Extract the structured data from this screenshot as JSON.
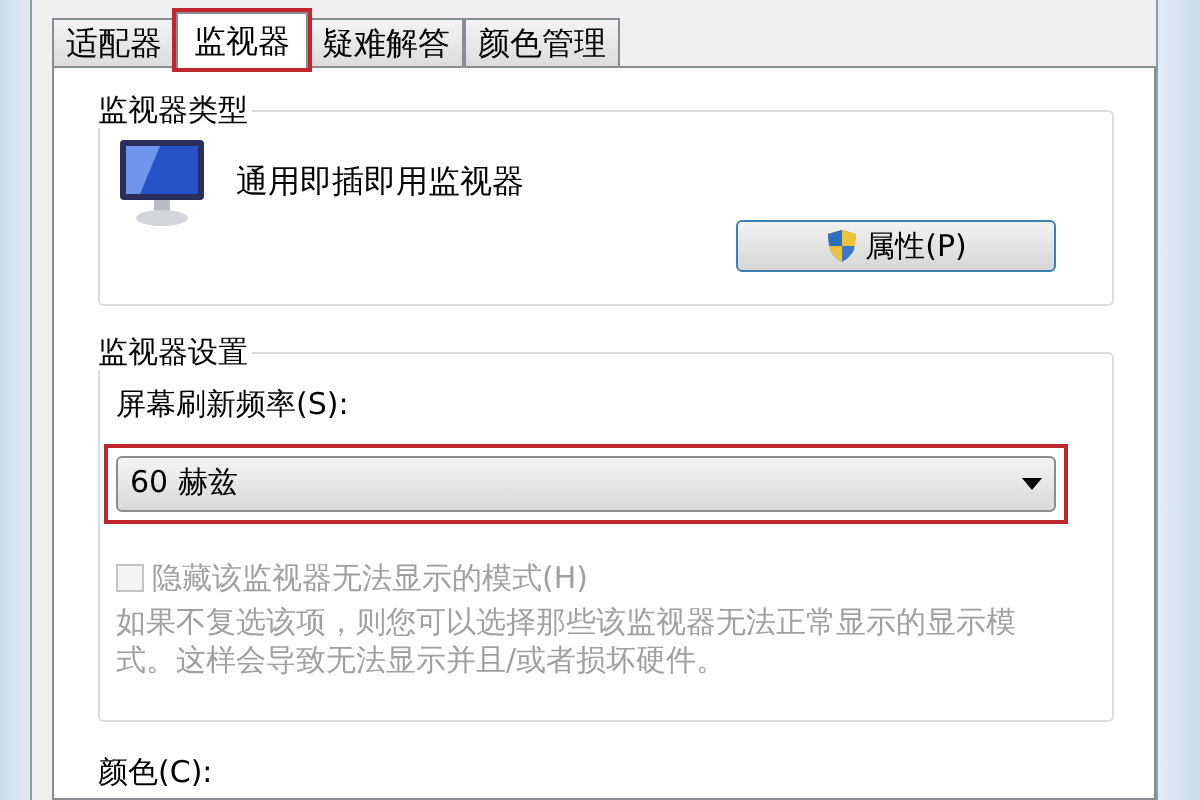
{
  "tabs": [
    {
      "label": "适配器",
      "selected": false,
      "highlighted": false
    },
    {
      "label": "监视器",
      "selected": true,
      "highlighted": true
    },
    {
      "label": "疑难解答",
      "selected": false,
      "highlighted": false
    },
    {
      "label": "颜色管理",
      "selected": false,
      "highlighted": false
    }
  ],
  "monitor_type": {
    "title": "监视器类型",
    "name": "通用即插即用监视器",
    "button": "属性(P)"
  },
  "monitor_settings": {
    "title": "监视器设置",
    "refresh_label": "屏幕刷新频率(S):",
    "refresh_value": "60 赫兹",
    "refresh_highlighted": true,
    "hide_modes": {
      "label": "隐藏该监视器无法显示的模式(H)",
      "checked": false,
      "disabled": true
    },
    "description": "如果不复选该项，则您可以选择那些该监视器无法正常显示的显示模式。这样会导致无法显示并且/或者损坏硬件。"
  },
  "color_label": "颜色(C):"
}
